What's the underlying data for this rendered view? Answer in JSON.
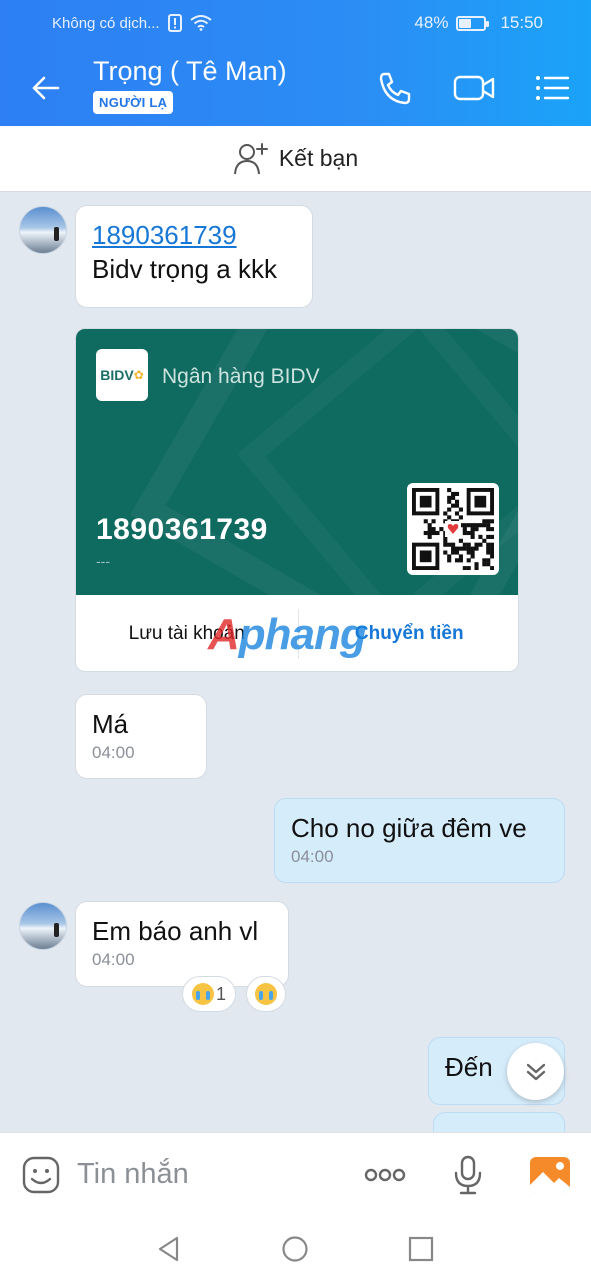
{
  "status_bar": {
    "carrier": "Không có dịch...",
    "battery": "48%",
    "battery_level": 0.48,
    "time": "15:50"
  },
  "header": {
    "contact_name": "Trọng ( Tê Man)",
    "badge": "NGƯỜI LẠ",
    "icons": [
      "back-arrow-icon",
      "phone-icon",
      "video-call-icon",
      "menu-list-icon"
    ]
  },
  "friend_bar": {
    "label": "Kết bạn",
    "icon": "add-friend-icon"
  },
  "messages": {
    "m1": {
      "line1": "1890361739",
      "line2": "Bidv trọng a kkk"
    },
    "bank_card": {
      "bank_logo": "BIDV",
      "bank_name": "Ngân hàng BIDV",
      "account_number": "1890361739",
      "account_holder": "---",
      "save_action": "Lưu tài khoản",
      "transfer_action": "Chuyển tiền",
      "card_color": "#0f6a60"
    },
    "m2": {
      "text": "Má",
      "time": "04:00"
    },
    "m3": {
      "text": "Cho no giữa đêm ve",
      "time": "04:00"
    },
    "m4": {
      "text": "Em báo anh vl",
      "time": "04:00",
      "reaction_count": "1"
    },
    "m5": {
      "text": "Đến "
    }
  },
  "watermark": {
    "part1": "A",
    "part2": "phang"
  },
  "input_bar": {
    "placeholder": "Tin nhắn",
    "icons": [
      "sticker-icon",
      "more-icon",
      "microphone-icon",
      "image-icon"
    ]
  },
  "colors": {
    "accent": "#2c8df5",
    "my_bubble": "#d5ecfb",
    "link": "#1677d6"
  }
}
